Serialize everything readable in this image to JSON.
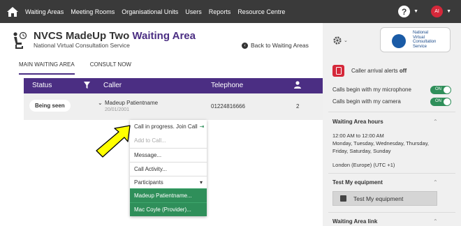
{
  "nav": {
    "items": [
      "Waiting Areas",
      "Meeting Rooms",
      "Organisational Units",
      "Users",
      "Reports",
      "Resource Centre"
    ],
    "help_icon": "?",
    "avatar_initials": "AI",
    "brand_color": "#3a3a3a"
  },
  "header": {
    "title_prefix": "NVCS MadeUp Two",
    "title_accent": "Waiting Area",
    "subtitle": "National Virtual Consultation Service",
    "back_link": "Back to Waiting Areas",
    "accent_color": "#4b2e83"
  },
  "tabs": [
    "MAIN WAITING AREA",
    "CONSULT NOW"
  ],
  "table": {
    "columns": [
      "Status",
      "Caller",
      "Telephone"
    ],
    "row": {
      "status": "Being seen",
      "caller_name": "Madeup Patientname",
      "caller_dob": "20/01/2001",
      "telephone": "01224816666",
      "count": "2"
    }
  },
  "menu": {
    "items": [
      "Call in progress. Join Call",
      "Add to Call...",
      "Message...",
      "Call Activity...",
      "Participants"
    ],
    "participants": [
      "Madeup Patientname...",
      "Mac Coyle (Provider)..."
    ]
  },
  "panel": {
    "logo_lines": [
      "National",
      "Virtual",
      "Consultation",
      "Service"
    ],
    "alerts_label": "Caller arrival alerts",
    "alerts_state": "off",
    "toggles": [
      {
        "label": "Calls begin with my microphone",
        "state": "ON"
      },
      {
        "label": "Calls begin with my camera",
        "state": "ON"
      }
    ],
    "hours_title": "Waiting Area hours",
    "hours_lines": [
      "12:00 AM to 12:00 AM",
      "Monday, Tuesday, Wednesday, Thursday,",
      "Friday, Saturday, Sunday"
    ],
    "timezone": "London (Europe) (UTC +1)",
    "test_title": "Test My equipment",
    "test_button": "Test My equipment",
    "link_title": "Waiting Area link"
  }
}
